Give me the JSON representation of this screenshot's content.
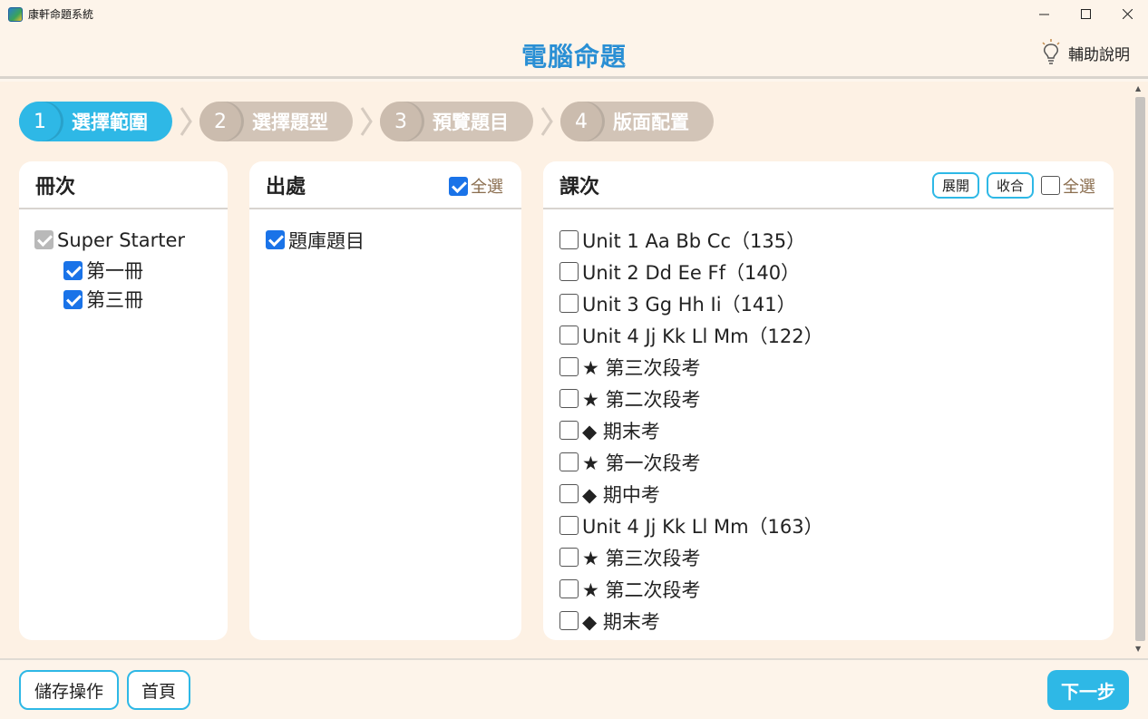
{
  "window": {
    "title": "康軒命題系統",
    "minimize": "—",
    "maximize": "☐",
    "close": "✕"
  },
  "header": {
    "title": "電腦命題",
    "help": "輔助說明"
  },
  "steps": [
    {
      "num": "1",
      "label": "選擇範圍",
      "active": true
    },
    {
      "num": "2",
      "label": "選擇題型",
      "active": false
    },
    {
      "num": "3",
      "label": "預覽題目",
      "active": false
    },
    {
      "num": "4",
      "label": "版面配置",
      "active": false
    }
  ],
  "volume_panel": {
    "title": "冊次",
    "series": "Super Starter",
    "items": [
      "第一冊",
      "第三冊"
    ]
  },
  "source_panel": {
    "title": "出處",
    "select_all": "全選",
    "items": [
      "題庫題目"
    ]
  },
  "lesson_panel": {
    "title": "課次",
    "expand": "展開",
    "collapse": "收合",
    "select_all": "全選",
    "items": [
      "Unit 1 Aa Bb Cc（135）",
      "Unit 2 Dd Ee Ff（140）",
      "Unit 3 Gg Hh Ii（141）",
      "Unit 4 Jj Kk Ll Mm（122）",
      "★ 第三次段考",
      "★ 第二次段考",
      "◆ 期末考",
      "★ 第一次段考",
      "◆ 期中考",
      "Unit 4 Jj Kk Ll Mm（163）",
      "★ 第三次段考",
      "★ 第二次段考",
      "◆ 期末考"
    ]
  },
  "footer": {
    "save": "儲存操作",
    "home": "首頁",
    "next": "下一步"
  }
}
